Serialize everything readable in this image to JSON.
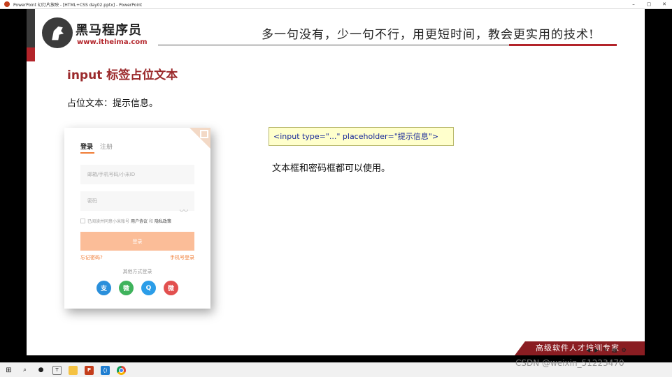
{
  "window": {
    "title": "PowerPoint 幻灯片放映 - [HTML+CSS day02.pptx] - PowerPoint",
    "minimize": "–",
    "restore": "▢",
    "close": "✕"
  },
  "header": {
    "logo_cn": "黑马程序员",
    "logo_url": "www.itheima.com",
    "slogan": "多一句没有，少一句不行，用更短时间，教会更实用的技术!"
  },
  "slide": {
    "title": "input 标签占位文本",
    "subtitle": "占位文本：提示信息。",
    "code": "<input type=\"...\" placeholder=\"提示信息\">",
    "note": "文本框和密码框都可以使用。"
  },
  "login_card": {
    "tab_login": "登录",
    "tab_register": "注册",
    "user_placeholder": "邮箱/手机号码/小米ID",
    "password_placeholder": "密码",
    "eye": "◡◡",
    "agree_prefix": "已阅读并同意小米账号",
    "agree_terms": "用户协议",
    "agree_and": "和",
    "agree_privacy": "隐私政策",
    "login_button": "登录",
    "forgot": "忘记密码?",
    "phone_login": "手机号登录",
    "other_methods": "其他方式登录",
    "socials": [
      "支",
      "微",
      "Q",
      "微"
    ]
  },
  "banner": {
    "text": "高级软件人才培训专家"
  },
  "bottom_controls": [
    "◀",
    "▶",
    "✎",
    "▦",
    "⚙"
  ],
  "taskbar": {
    "icons": [
      "⊞",
      "⌕",
      "●",
      "T",
      "▇",
      "P",
      "⟨⟩",
      ""
    ]
  },
  "watermark": "CSDN @weixin_51223470"
}
